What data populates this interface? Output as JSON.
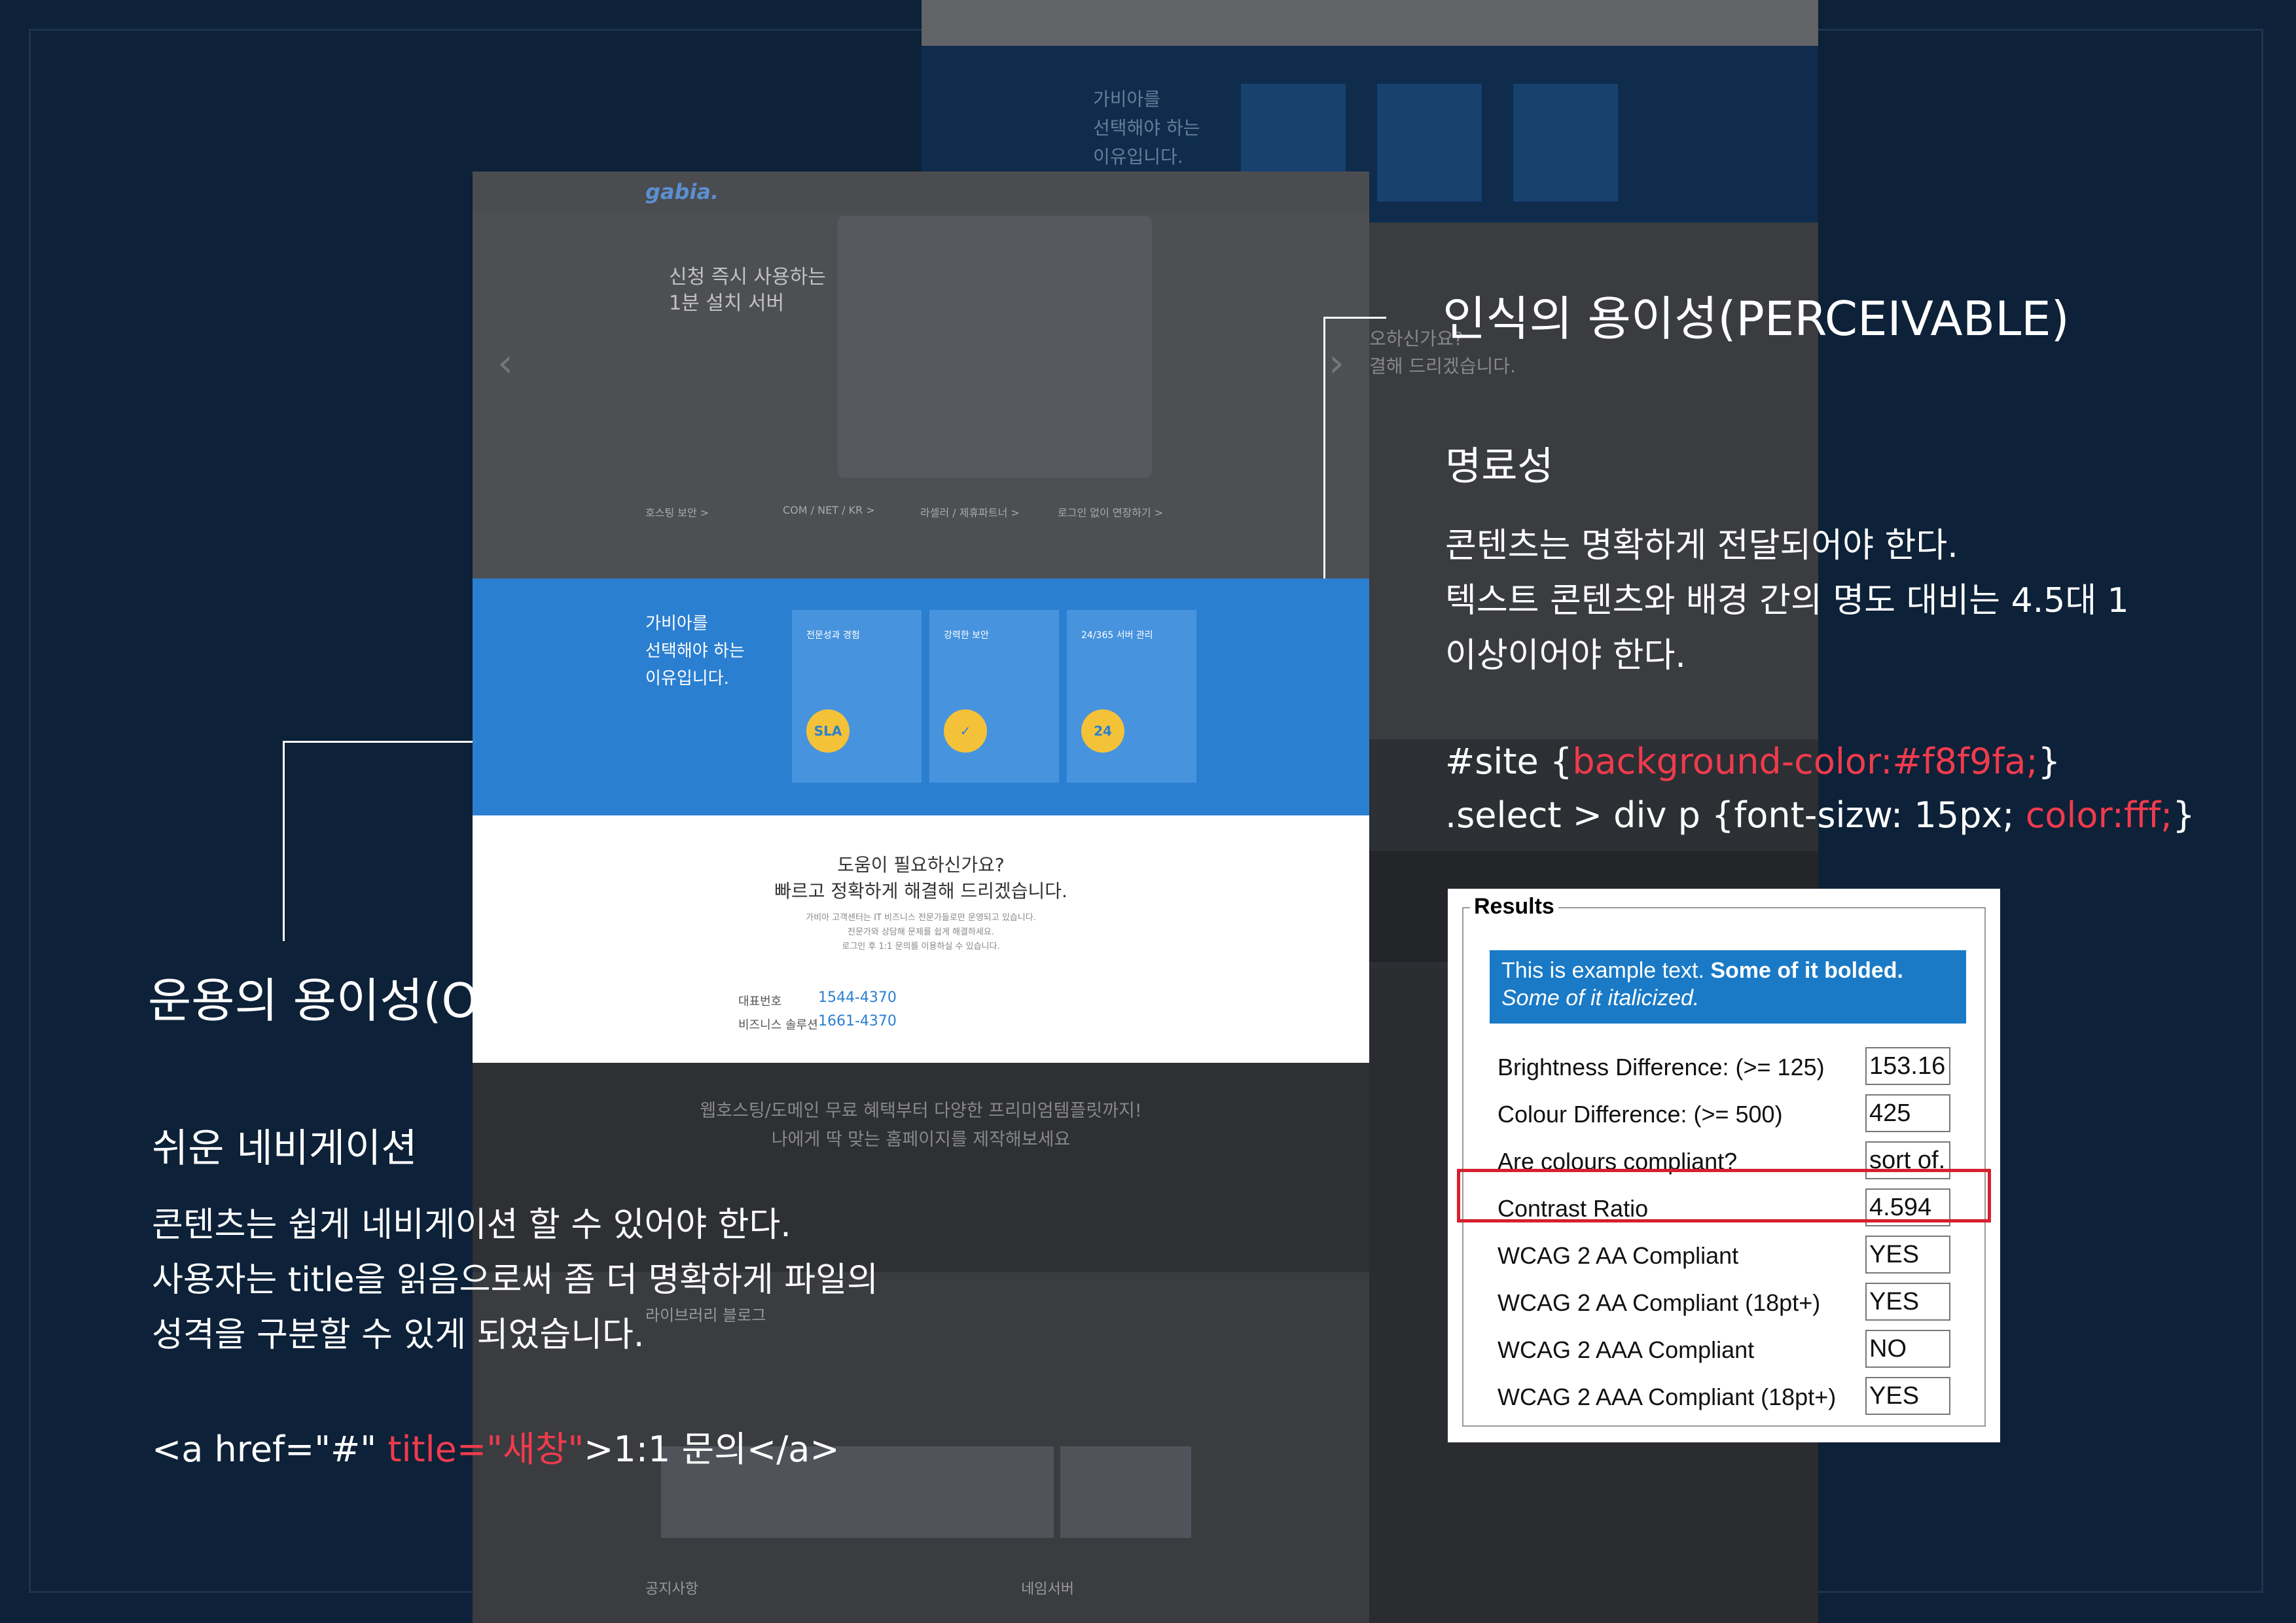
{
  "background_page": {
    "reasons": "가비아를\n선택해야 하는\n이유입니다.",
    "help_partial": "오하신가요?",
    "help_partial2": "결해 드리겠습니다."
  },
  "main_page": {
    "logo": "gabia.",
    "hero_title": "신청 즉시 사용하는\n1분 설치 서버",
    "features": [
      "호스팅 보안 >",
      "COM / NET / KR >",
      "라셀러 / 제휴파트너 >",
      "로그인 없이 연장하기 >"
    ],
    "band_title": "가비아를\n선택해야 하는\n이유입니다.",
    "band_cards": [
      {
        "title": "전문성과 경험",
        "icon": "SLA"
      },
      {
        "title": "강력한 보안",
        "icon": "✓"
      },
      {
        "title": "24/365 서버 관리",
        "icon": "24"
      }
    ],
    "help_title1": "도움이 필요하신가요?",
    "help_title2": "빠르고 정확하게 해결해 드리겠습니다.",
    "help_small": "가비아 고객센터는 IT 비즈니스 전문가들로만 운영되고 있습니다.\n전문가와 상담해 문제를 쉽게 해결하세요.\n로그인 후 1:1 문의를 이용하실 수 있습니다.",
    "phone_label1": "대표번호",
    "phone_num1": "1544-4370",
    "phone_label2": "비즈니스 솔루션",
    "phone_num2": "1661-4370",
    "dark_text": "웹호스팅/도메인 무료 혜택부터 다양한 프리미엄템플릿까지!\n나에게 딱 맞는 홈페이지를 제작해보세요",
    "blog_title": "라이브러리 블로그",
    "notice": "공지사항",
    "new_server": "네임서버"
  },
  "perceivable": {
    "title": "인식의 용이성(PERCEIVABLE)",
    "subtitle": "명료성",
    "body": "콘텐츠는 명확하게 전달되어야 한다.\n텍스트 콘텐츠와 배경 간의 명도 대비는 4.5대 1\n이상이어야 한다.",
    "code1_a": "#site {",
    "code1_b": "background-color:#f8f9fa;",
    "code1_c": "}",
    "code2_a": ".select > div p {font-sizw: 15px; ",
    "code2_b": "color:fff;",
    "code2_c": "}"
  },
  "operable": {
    "title": "운용의 용이성(OPERABLE)",
    "subtitle": "쉬운 네비게이션",
    "body": "콘텐츠는 쉽게 네비게이션 할 수 있어야 한다.\n사용자는 title을 읽음으로써 좀 더 명확하게 파일의\n성격을 구분할 수 있게 되었습니다.",
    "code_a": "<a href=\"#\" ",
    "code_b": "title=\"새창\"",
    "code_c": ">1:1 문의</a>"
  },
  "results": {
    "legend": "Results",
    "sample_normal": "This is example text.",
    "sample_bold": "Some of it bolded.",
    "sample_italic": "Some of it italicized.",
    "rows": [
      {
        "label": "Brightness Difference: (>= 125)",
        "value": "153.16"
      },
      {
        "label": "Colour Difference: (>= 500)",
        "value": "425"
      },
      {
        "label": "Are colours compliant?",
        "value": "sort of."
      },
      {
        "label": "Contrast Ratio",
        "value": "4.594"
      },
      {
        "label": "WCAG 2 AA Compliant",
        "value": "YES"
      },
      {
        "label": "WCAG 2 AA Compliant (18pt+)",
        "value": "YES"
      },
      {
        "label": "WCAG 2 AAA Compliant",
        "value": "NO"
      },
      {
        "label": "WCAG 2 AAA Compliant (18pt+)",
        "value": "YES"
      }
    ]
  }
}
